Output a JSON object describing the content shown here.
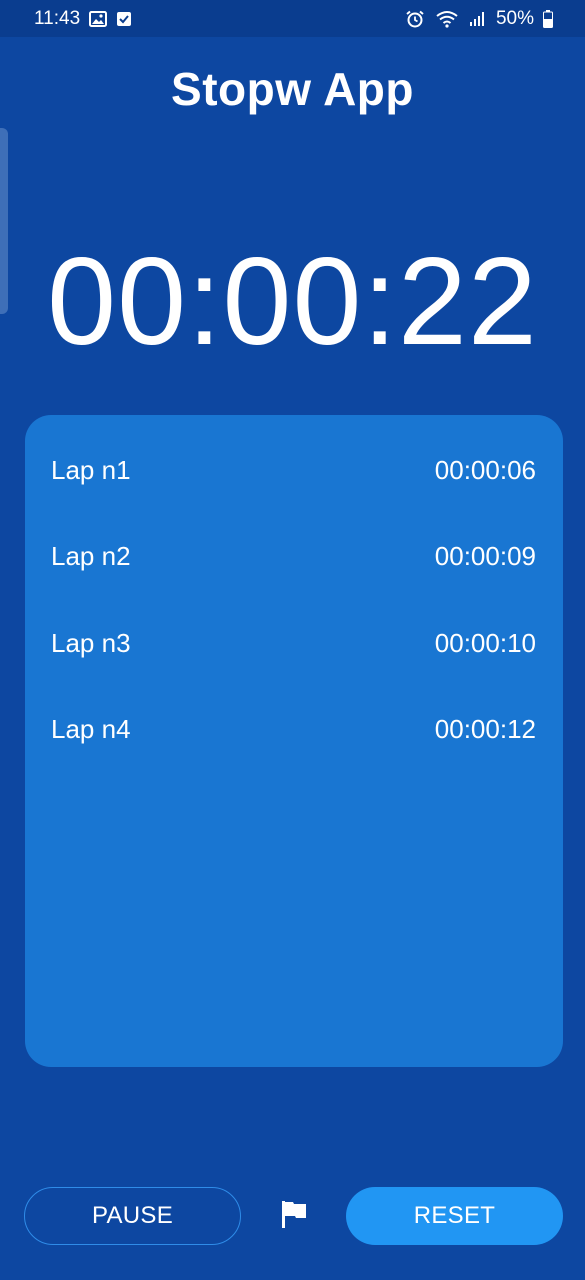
{
  "status_bar": {
    "time": "11:43",
    "battery_text": "50%",
    "left_icons": [
      "image-icon",
      "checkbox-icon"
    ],
    "right_icons": [
      "alarm-icon",
      "wifi-icon",
      "signal-icon",
      "battery-icon"
    ]
  },
  "app": {
    "title": "Stopw App"
  },
  "timer": {
    "display": "00:00:22"
  },
  "laps": [
    {
      "label": "Lap n1",
      "time": "00:00:06"
    },
    {
      "label": "Lap n2",
      "time": "00:00:09"
    },
    {
      "label": "Lap n3",
      "time": "00:00:10"
    },
    {
      "label": "Lap n4",
      "time": "00:00:12"
    }
  ],
  "controls": {
    "pause_label": "PAUSE",
    "reset_label": "RESET",
    "flag_icon": "flag-icon"
  },
  "colors": {
    "background": "#0d47a1",
    "card": "#1976d2",
    "accent": "#2196f3"
  }
}
